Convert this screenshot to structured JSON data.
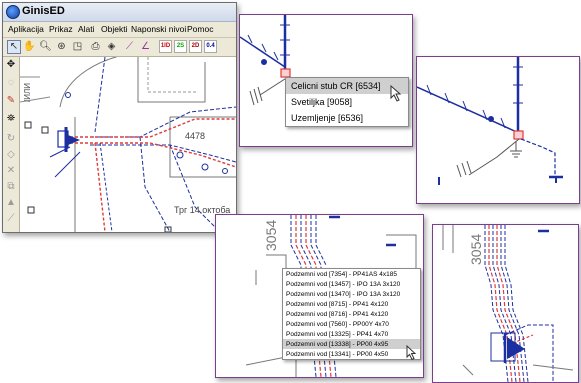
{
  "app": {
    "title": "GinisED",
    "menu": [
      "Aplikacija",
      "Prikaz",
      "Alati",
      "Objekti",
      "Naponski nivoi",
      "Pomoc"
    ],
    "toolbar_badges": [
      "1ID",
      "2S",
      "2D",
      "0.4"
    ],
    "map_labels": {
      "parcel": "4478",
      "street": "Трг  14.октоба",
      "vertical": "/ИЛИ"
    }
  },
  "popup_pole": {
    "items": [
      "Celicni stub CR [6534]",
      "Svetiljka [9058]",
      "Uzemljenje [6536]"
    ],
    "highlighted_index": 0
  },
  "popup_cables": {
    "map_label": "3054",
    "items": [
      "Podzemni vod [7354] - PP41AS 4x185",
      "Podzemni vod [13457] - IPO 13A 3x120",
      "Podzemni vod [13470] - IPO 13A 3x120",
      "Podzemni vod [8715] - PP41 4x120",
      "Podzemni vod [8716] - PP41 4x120",
      "Podzemni vod [7560] - PP00Y 4x70",
      "Podzemni vod [13325] - PP41 4x70",
      "Podzemni vod [13338] - PP00 4x95",
      "Podzemni vod [13341] - PP00 4x50"
    ],
    "highlighted_index": 7
  },
  "panel_cables_zoom": {
    "map_label": "3054"
  },
  "colors": {
    "wire_blue": "#1c2fa0",
    "selection_red": "#e03a3a",
    "highlight_gray": "#cfcfcf",
    "window_chrome": "#ece9d8"
  }
}
